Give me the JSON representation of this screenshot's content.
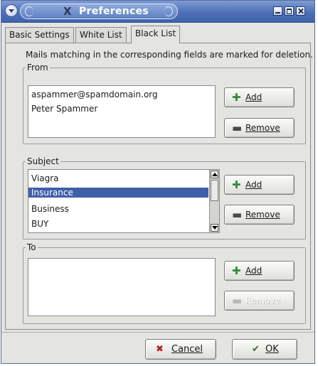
{
  "window": {
    "title": "Preferences",
    "title_glyph": "X"
  },
  "tabs": [
    {
      "label": "Basic Settings",
      "active": false
    },
    {
      "label": "White List",
      "active": false
    },
    {
      "label": "Black List",
      "active": true
    }
  ],
  "description": "Mails matching in the corresponding fields are marked for deletion.",
  "groups": {
    "from": {
      "label": "From",
      "items": [
        "aspammer@spamdomain.org",
        "Peter Spammer"
      ],
      "add_label": "Add",
      "remove_label": "Remove"
    },
    "subject": {
      "label": "Subject",
      "items": [
        "Viagra",
        "Insurance",
        "Business",
        "BUY"
      ],
      "selected": "Insurance",
      "add_label": "Add",
      "remove_label": "Remove"
    },
    "to": {
      "label": "To",
      "items": [],
      "add_label": "Add",
      "remove_label": "Remove",
      "remove_enabled": false
    }
  },
  "dialog_buttons": {
    "cancel_label": "Cancel",
    "ok_label": "OK"
  },
  "colors": {
    "title_bar": "#4d70b8",
    "selection": "#3f5fa8",
    "window_bg": "#e4e4e0"
  },
  "icons": {
    "add": "plus-icon",
    "remove": "minus-icon",
    "cancel": "x-icon",
    "ok": "check-icon"
  }
}
